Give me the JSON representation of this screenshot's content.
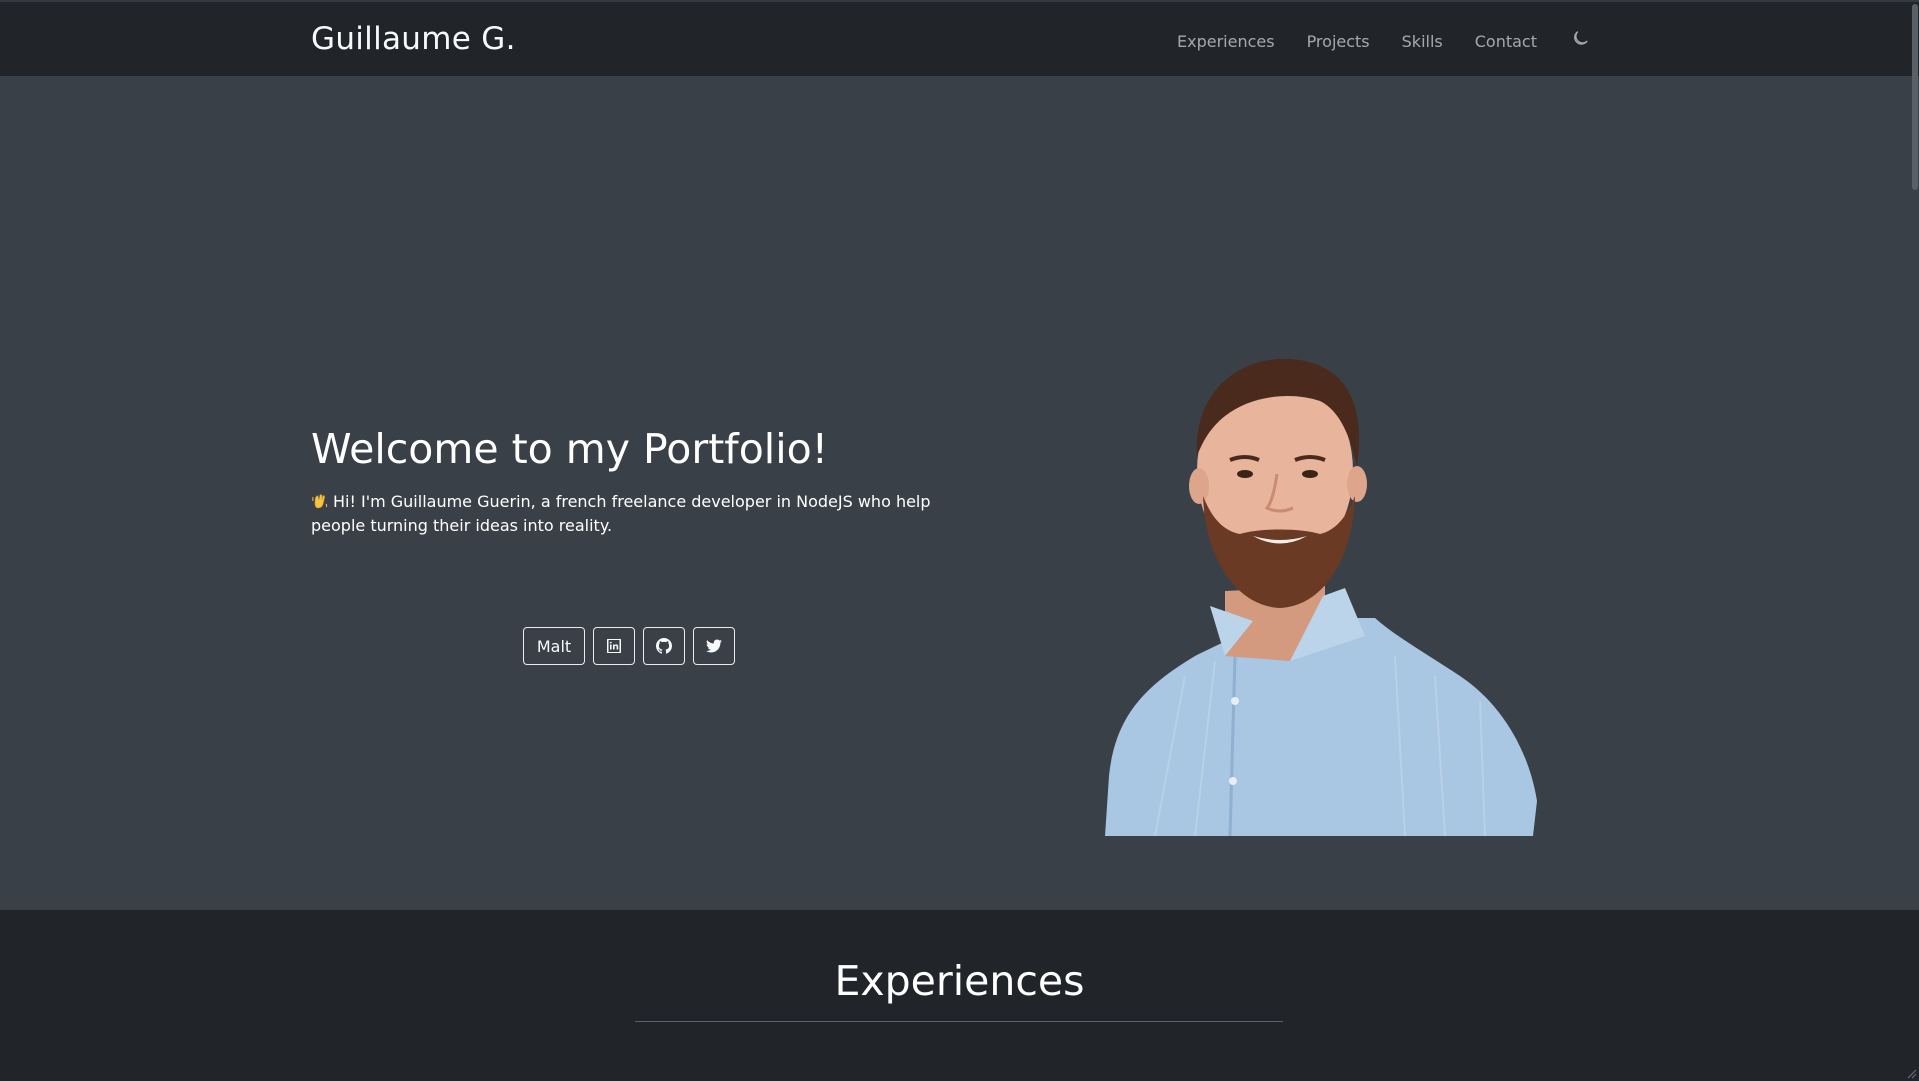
{
  "navbar": {
    "brand": "Guillaume G.",
    "links": [
      "Experiences",
      "Projects",
      "Skills",
      "Contact"
    ],
    "theme_toggle_icon": "moon-icon"
  },
  "hero": {
    "title": "Welcome to my Portfolio!",
    "wave_icon": "waving-hand-icon",
    "intro": "Hi! I'm Guillaume Guerin, a french freelance developer in NodeJS who help people turning their ideas into reality.",
    "buttons": {
      "malt_label": "Malt",
      "linkedin_icon": "linkedin-icon",
      "github_icon": "github-icon",
      "twitter_icon": "twitter-icon"
    },
    "portrait_alt": "portrait photo"
  },
  "experiences": {
    "title": "Experiences"
  },
  "colors": {
    "navbar_bg": "#212529",
    "hero_bg": "#3a4048",
    "text": "#ffffff",
    "nav_link": "rgba(255,255,255,0.60)",
    "shirt": "#a9c6e2",
    "beard": "#6b3a24"
  }
}
